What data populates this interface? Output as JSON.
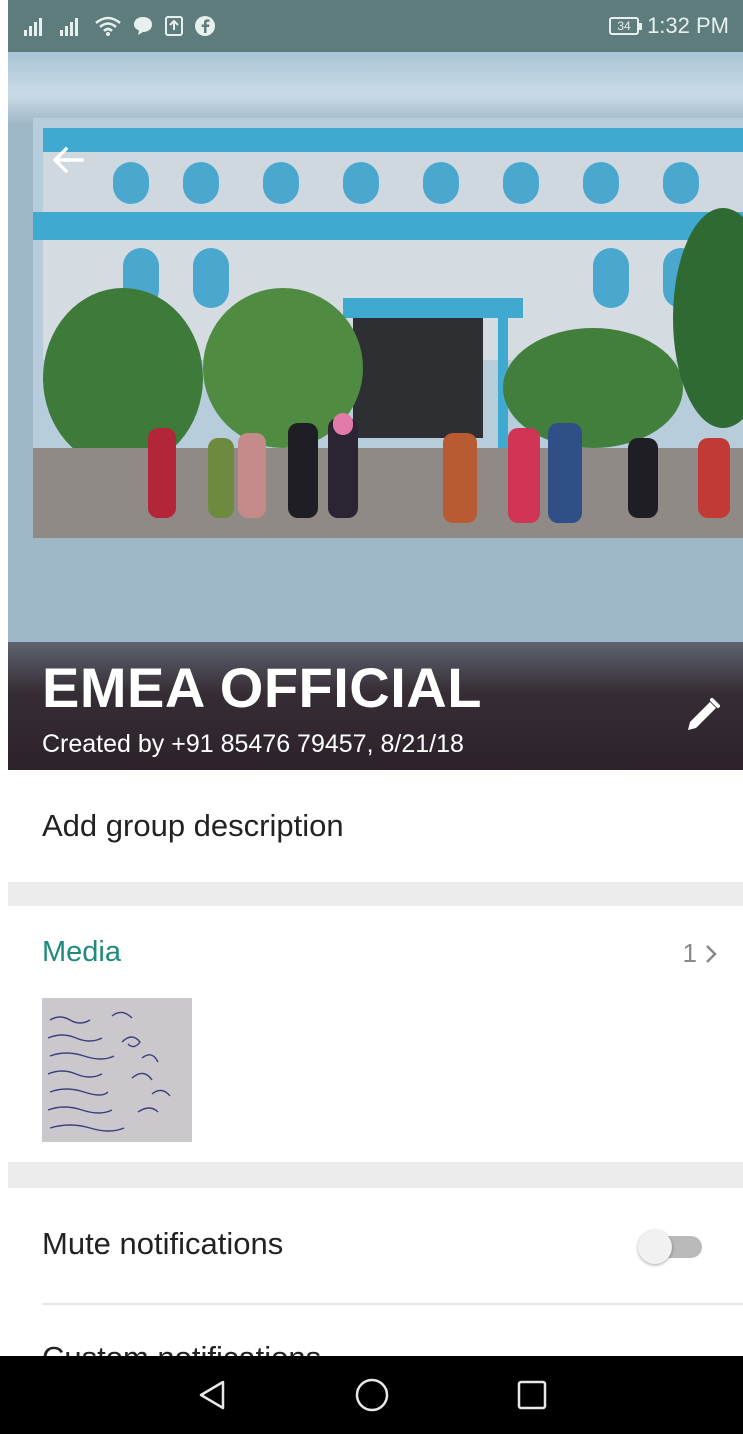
{
  "status_bar": {
    "battery": "34",
    "time": "1:32 PM"
  },
  "group": {
    "name": "EMEA OFFICIAL",
    "created": "Created by +91 85476 79457, 8/21/18"
  },
  "description": {
    "placeholder": "Add group description"
  },
  "media": {
    "label": "Media",
    "count": "1"
  },
  "settings": {
    "mute_label": "Mute notifications",
    "mute_enabled": false,
    "next_row_label": "Custom notifications"
  },
  "colors": {
    "status_bar": "#5d7c7b",
    "accent": "#1f8a7a",
    "divider": "#ececec"
  }
}
